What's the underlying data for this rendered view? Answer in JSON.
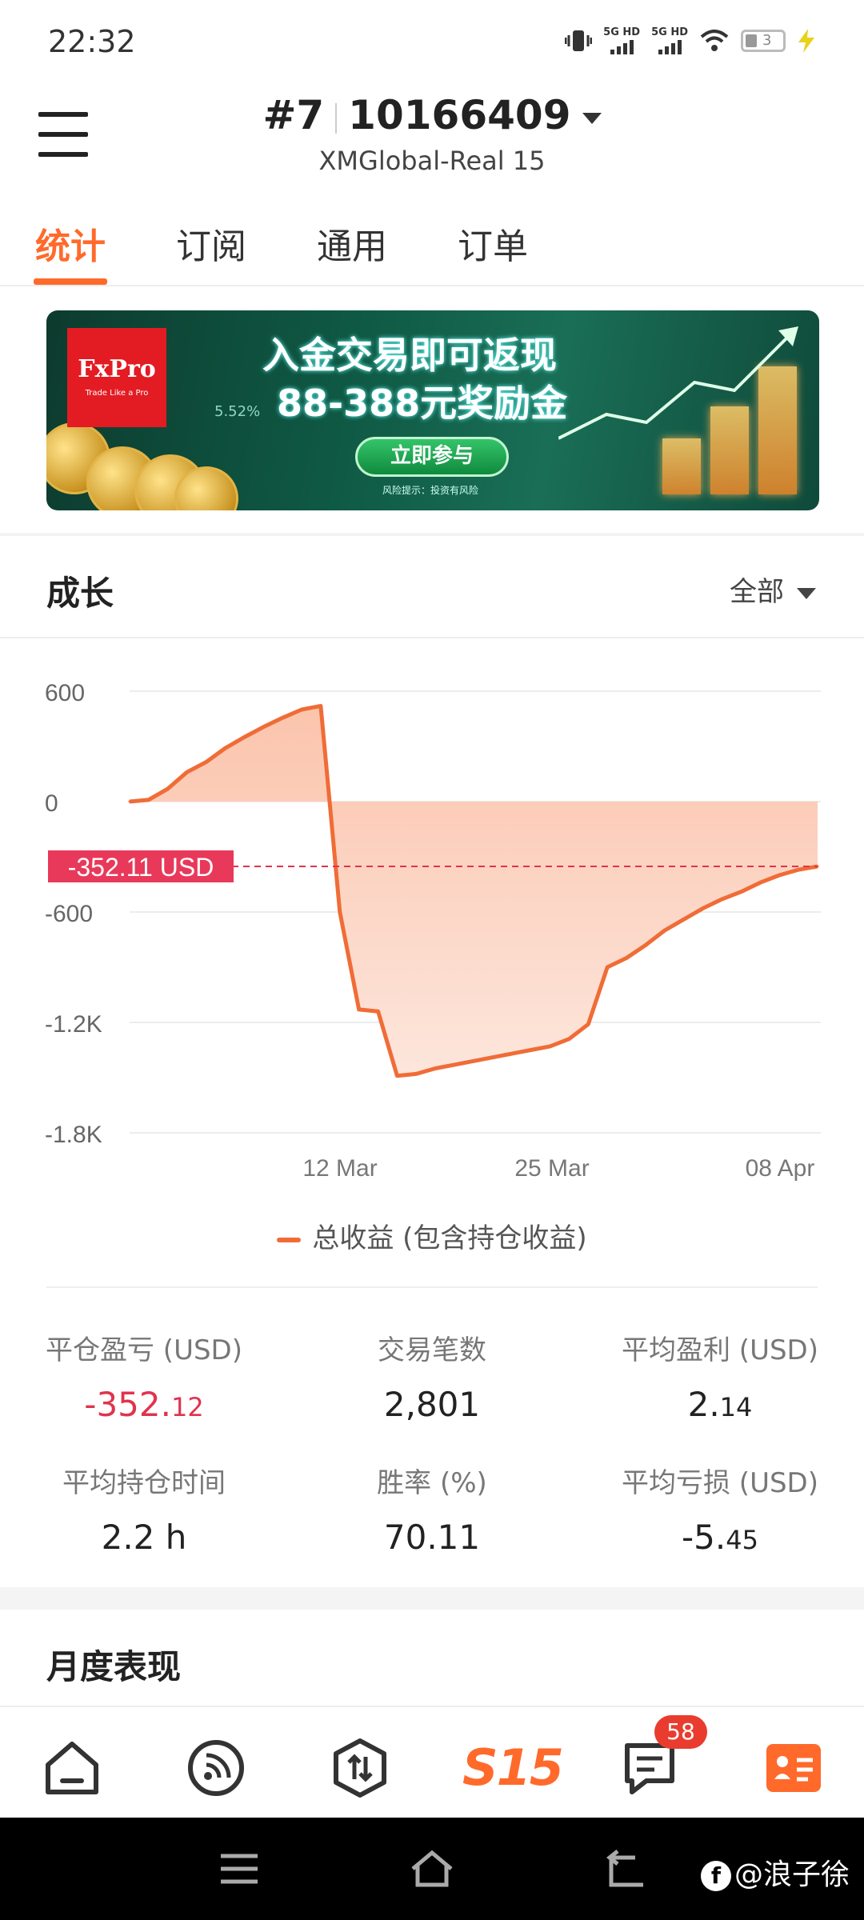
{
  "status_bar": {
    "time": "22:32",
    "sim1": "5G HD",
    "sim2": "5G HD",
    "battery": "3"
  },
  "header": {
    "account_index": "#7",
    "account_number": "10166409",
    "server": "XMGlobal-Real 15"
  },
  "tabs": [
    {
      "label": "统计",
      "active": true
    },
    {
      "label": "订阅",
      "active": false
    },
    {
      "label": "通用",
      "active": false
    },
    {
      "label": "订单",
      "active": false
    }
  ],
  "banner": {
    "logo_name": "FxPro",
    "logo_tagline": "Trade Like a Pro",
    "percent": "5.52%",
    "headline": "入金交易即可返现",
    "subheadline": "88-388元奖励金",
    "cta": "立即参与",
    "risk_note": "风险提示：投资有风险"
  },
  "growth": {
    "title": "成长",
    "range": "全部"
  },
  "chart_data": {
    "type": "area",
    "title": "",
    "xlabel": "",
    "ylabel": "",
    "ylim": [
      -1800,
      600
    ],
    "y_ticks": [
      "600",
      "0",
      "-600",
      "-1.2K",
      "-1.8K"
    ],
    "x_ticks": [
      "12 Mar",
      "25 Mar",
      "08 Apr"
    ],
    "current_value_label": "-352.11 USD",
    "current_value": -352.11,
    "series": [
      {
        "name": "总收益 (包含持仓收益)",
        "color": "#f06c37",
        "x": [
          "04 Mar",
          "05 Mar",
          "06 Mar",
          "07 Mar",
          "08 Mar",
          "09 Mar",
          "10 Mar",
          "11 Mar",
          "12 Mar",
          "13 Mar",
          "14 Mar",
          "15 Mar",
          "15 Mar",
          "16 Mar",
          "17 Mar",
          "18 Mar",
          "19 Mar",
          "20 Mar",
          "21 Mar",
          "22 Mar",
          "23 Mar",
          "24 Mar",
          "25 Mar",
          "26 Mar",
          "27 Mar",
          "28 Mar",
          "29 Mar",
          "30 Mar",
          "31 Mar",
          "01 Apr",
          "02 Apr",
          "03 Apr",
          "04 Apr",
          "05 Apr",
          "06 Apr",
          "07 Apr",
          "08 Apr"
        ],
        "values": [
          0,
          10,
          70,
          160,
          215,
          290,
          350,
          405,
          455,
          500,
          520,
          -600,
          -1130,
          -1140,
          -1490,
          -1480,
          -1450,
          -1430,
          -1410,
          -1390,
          -1370,
          -1350,
          -1330,
          -1290,
          -1210,
          -900,
          -850,
          -780,
          -700,
          -640,
          -580,
          -530,
          -490,
          -440,
          -400,
          -370,
          -352.11
        ]
      }
    ]
  },
  "stats": [
    {
      "label": "平仓盈亏 (USD)",
      "value_main": "-352.",
      "value_frac": "12",
      "negative": true
    },
    {
      "label": "交易笔数",
      "value_main": "2,801",
      "value_frac": "",
      "negative": false
    },
    {
      "label": "平均盈利 (USD)",
      "value_main": "2.",
      "value_frac": "14",
      "negative": false
    },
    {
      "label": "平均持仓时间",
      "value_main": "2.2 h",
      "value_frac": "",
      "negative": false
    },
    {
      "label": "胜率 (%)",
      "value_main": "70.11",
      "value_frac": "",
      "negative": false
    },
    {
      "label": "平均亏损 (USD)",
      "value_main": "-5.",
      "value_frac": "45",
      "negative": false
    }
  ],
  "monthly": {
    "title": "月度表现"
  },
  "bottom_nav": {
    "s15_label": "S15",
    "messages_badge": "58"
  },
  "watermark": "@浪子徐",
  "colors": {
    "accent": "#ff6a2b",
    "negative": "#e0334e",
    "line": "#f06c37"
  }
}
